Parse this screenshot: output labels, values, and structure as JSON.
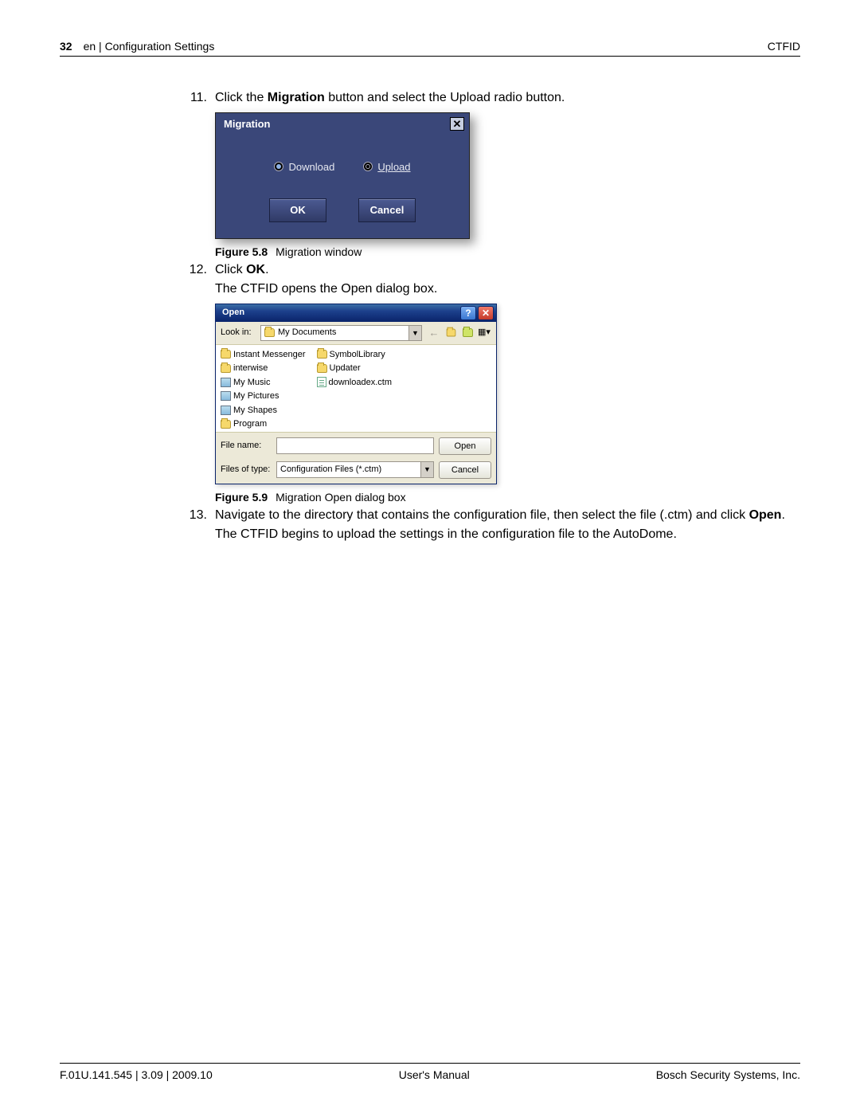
{
  "header": {
    "page_num": "32",
    "section": "en | Configuration Settings",
    "product": "CTFID"
  },
  "steps": {
    "s11": {
      "num": "11.",
      "text_pre": "Click the ",
      "text_bold": "Migration",
      "text_post": " button and select the Upload radio button."
    },
    "s12": {
      "num": "12.",
      "line1_pre": "Click ",
      "line1_bold": "OK",
      "line1_post": ".",
      "line2": "The CTFID opens the Open dialog box."
    },
    "s13": {
      "num": "13.",
      "line1_pre": "Navigate to the directory that contains the configuration file, then select the file (.ctm) and click ",
      "line1_bold": "Open",
      "line1_post": ".",
      "line2": "The CTFID begins to upload the settings in the configuration file to the AutoDome."
    }
  },
  "fig58": {
    "label": "Figure 5.8",
    "caption": "Migration window",
    "title": "Migration",
    "radio_download": "Download",
    "radio_upload": "Upload",
    "btn_ok": "OK",
    "btn_cancel": "Cancel"
  },
  "fig59": {
    "label": "Figure 5.9",
    "caption": "Migration Open dialog box",
    "title": "Open",
    "lookin_label": "Look in:",
    "lookin_value": "My Documents",
    "col1": [
      "Instant Messenger",
      "interwise",
      "My Music",
      "My Pictures",
      "My Shapes",
      "Program"
    ],
    "col2": [
      "SymbolLibrary",
      "Updater",
      "downloadex.ctm"
    ],
    "filename_label": "File name:",
    "filename_value": "",
    "filetype_label": "Files of type:",
    "filetype_value": "Configuration Files (*.ctm)",
    "btn_open": "Open",
    "btn_cancel": "Cancel"
  },
  "footer": {
    "left": "F.01U.141.545 | 3.09 | 2009.10",
    "center": "User's Manual",
    "right": "Bosch Security Systems, Inc."
  }
}
